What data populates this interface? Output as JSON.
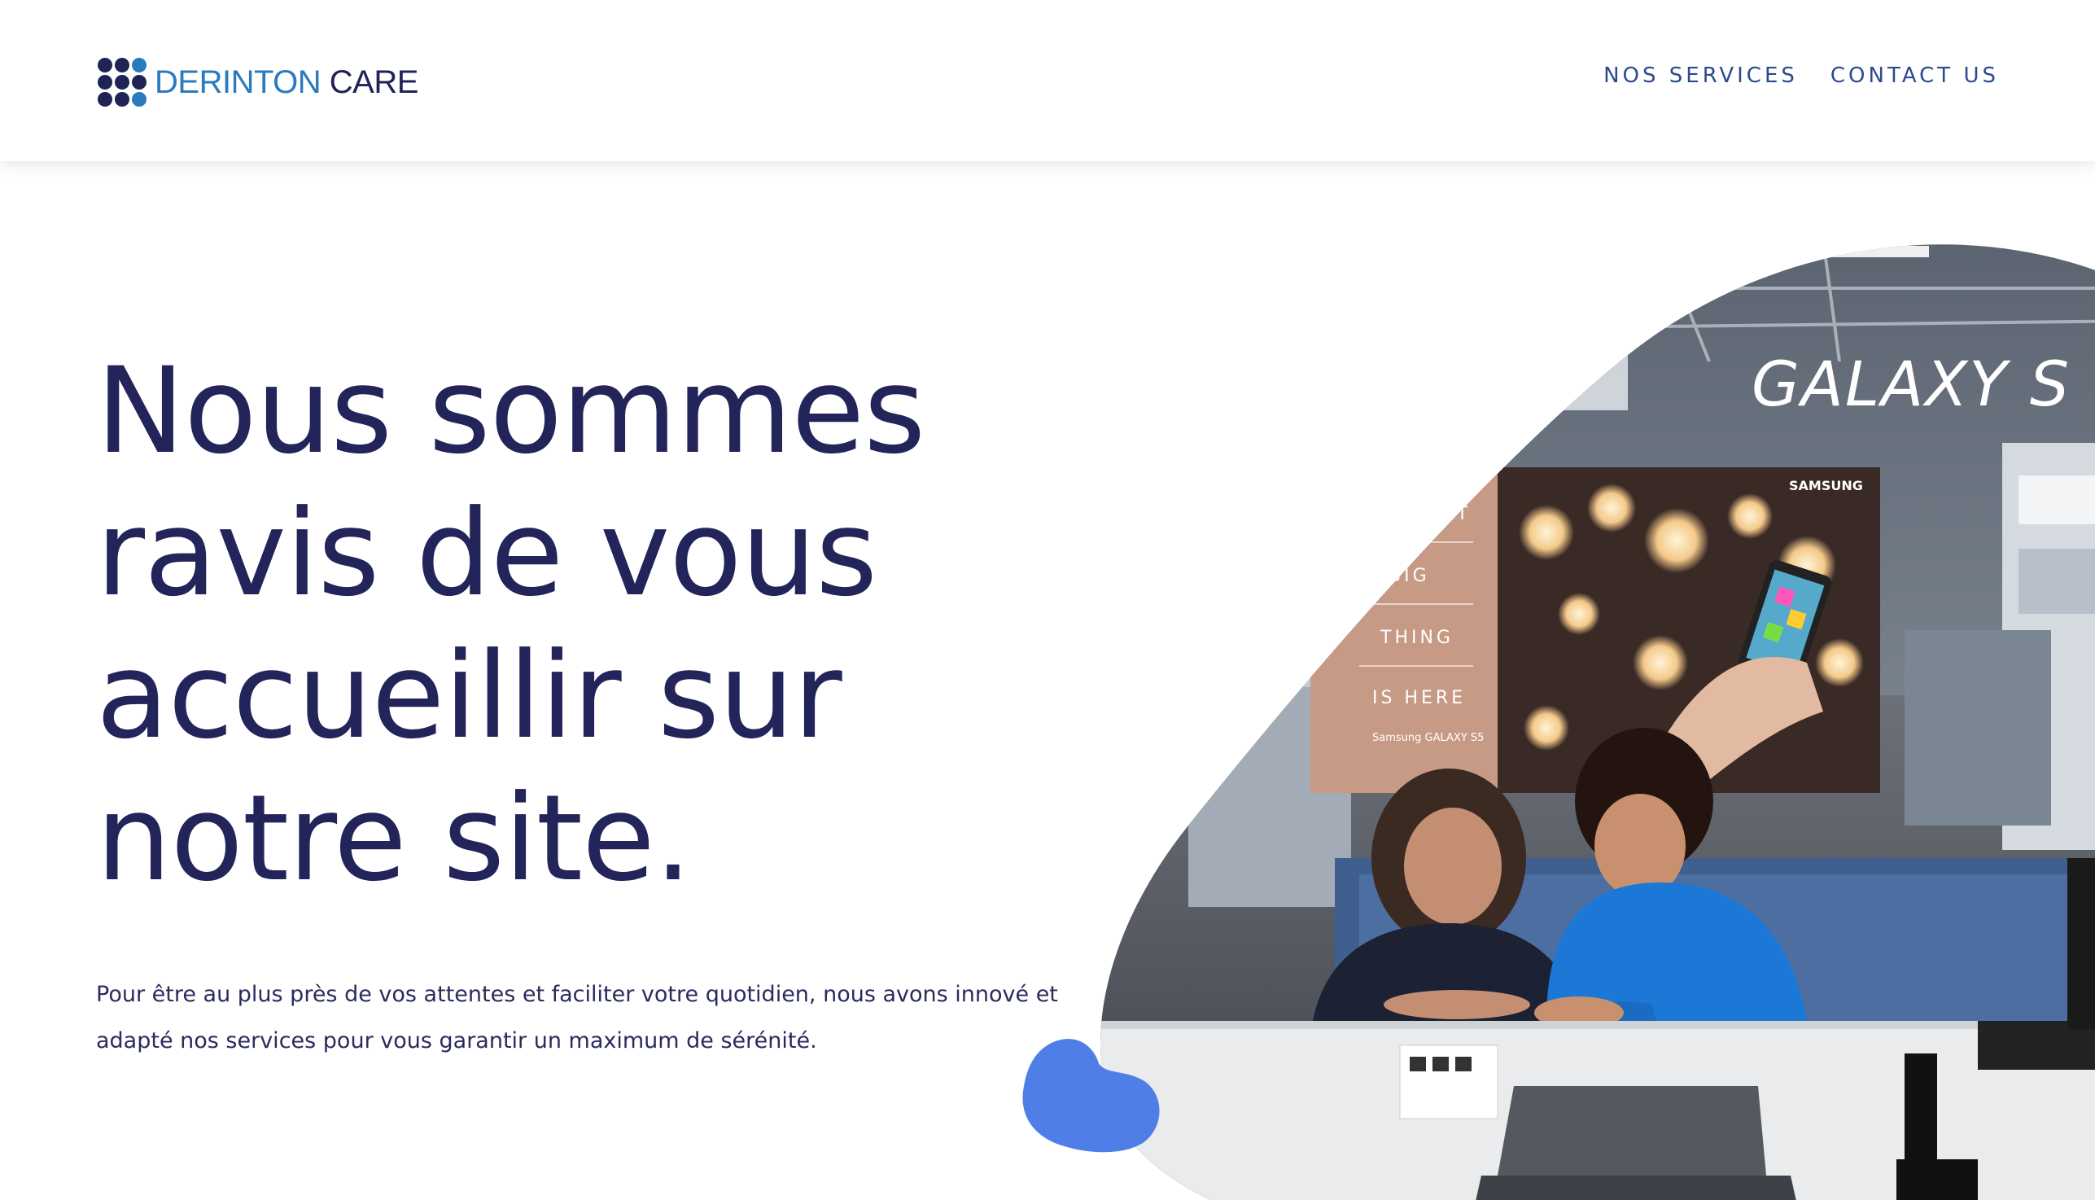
{
  "header": {
    "logo": {
      "word1": "DERINTON",
      "word2": "CARE",
      "icon": "dots-grid-icon"
    },
    "nav": [
      {
        "label": "NOS SERVICES"
      },
      {
        "label": "CONTACT US"
      }
    ]
  },
  "hero": {
    "title_lines": [
      "Nous sommes",
      "ravis de vous",
      "accueillir sur",
      "notre site."
    ],
    "paragraph_lines": [
      "Pour être au plus près de vos attentes et faciliter votre quotidien, nous avons innové et",
      "adapté nos services pour vous garantir un maximum de sérénité."
    ]
  },
  "image": {
    "brand_sign": "GALAXY S",
    "poster_brand": "SAMSUNG",
    "poster_lines": [
      "THE NEXT",
      "BIG",
      "THING",
      "IS HERE"
    ],
    "poster_footer": "Samsung GALAXY S5"
  },
  "colors": {
    "heading": "#22245a",
    "nav": "#2b4a8f",
    "logo_blue": "#2a7ac0",
    "logo_dark": "#1f2356",
    "accent_blob": "#4f7fe6"
  }
}
